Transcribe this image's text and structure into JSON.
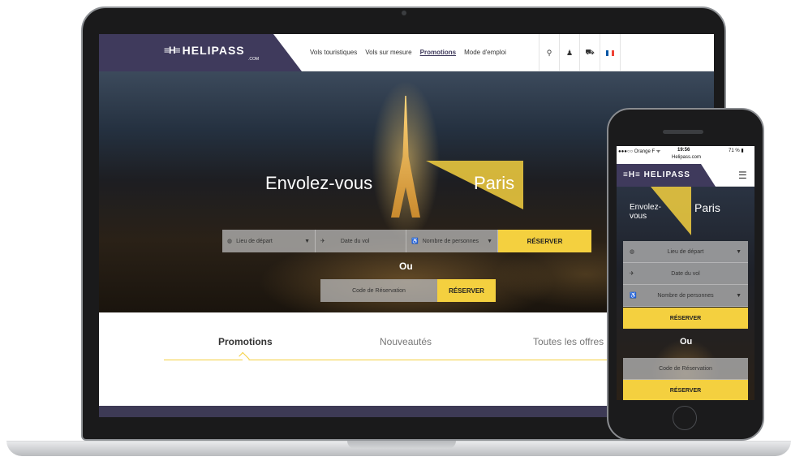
{
  "laptop": {
    "brand": {
      "mark": "≡H≡",
      "name": "HELIPASS",
      "sub": ".COM"
    },
    "nav": [
      {
        "label": "Vols touristiques",
        "active": false
      },
      {
        "label": "Vols sur mesure",
        "active": false
      },
      {
        "label": "Promotions",
        "active": true
      },
      {
        "label": "Mode d'emploi",
        "active": false
      }
    ],
    "nav_icons": {
      "search": "⚲",
      "user": "♟",
      "cart": "⛟"
    },
    "flag_colors": [
      "#0055a4",
      "#ffffff",
      "#ef4135"
    ],
    "hero": {
      "title_left": "Envolez-vous",
      "title_right": "Paris"
    },
    "search": {
      "departure": "Lieu de départ",
      "date": "Date du vol",
      "people": "Nombre de personnes",
      "reserve": "RÉSERVER"
    },
    "or_label": "Ou",
    "code": {
      "placeholder": "Code de Réservation",
      "reserve": "RÉSERVER"
    },
    "tabs": [
      {
        "label": "Promotions",
        "active": true
      },
      {
        "label": "Nouveautés",
        "active": false
      },
      {
        "label": "Toutes les offres",
        "active": false
      }
    ]
  },
  "phone": {
    "status": {
      "carrier": "●●●○○ Orange F ᯤ",
      "time": "19:56",
      "battery": "71 % ▮",
      "url": "Helipass.com"
    },
    "brand": "≡H≡ HELIPASS",
    "menu_icon": "☰",
    "hero": {
      "title_left": "Envolez-vous",
      "title_right": "Paris"
    },
    "departure": "Lieu de départ",
    "date": "Date du vol",
    "people": "Nombre de personnes",
    "reserve": "RÉSERVER",
    "or_label": "Ou",
    "code": "Code de Réservation",
    "code_reserve": "RÉSERVER"
  },
  "colors": {
    "brand": "#3f3a5c",
    "accent": "#f4d03f"
  }
}
